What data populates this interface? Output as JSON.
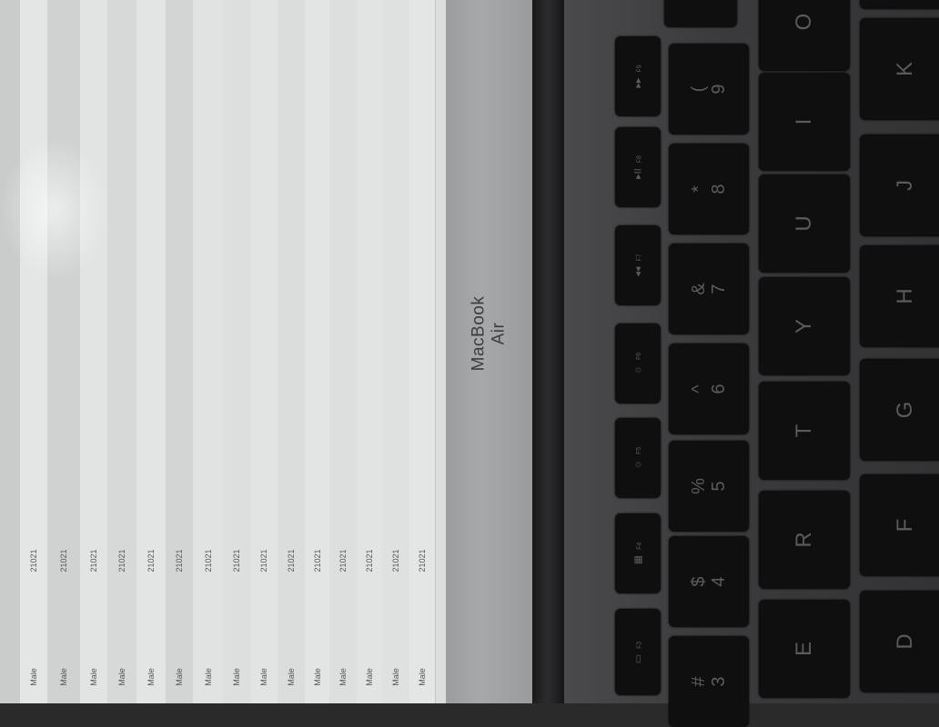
{
  "screen": {
    "table_rows": [
      {
        "gender": "Male",
        "code": "21021"
      },
      {
        "gender": "Male",
        "code": "21021"
      },
      {
        "gender": "Male",
        "code": "21021"
      },
      {
        "gender": "Male",
        "code": "21021"
      },
      {
        "gender": "Male",
        "code": "21021"
      },
      {
        "gender": "Male",
        "code": "21021"
      },
      {
        "gender": "Male",
        "code": "21021"
      },
      {
        "gender": "Male",
        "code": "21021"
      },
      {
        "gender": "Male",
        "code": "21021"
      },
      {
        "gender": "Male",
        "code": "21021"
      },
      {
        "gender": "Male",
        "code": "21021"
      },
      {
        "gender": "Male",
        "code": "21021"
      },
      {
        "gender": "Male",
        "code": "21021"
      },
      {
        "gender": "Male",
        "code": "21021"
      },
      {
        "gender": "Male",
        "code": "21021"
      }
    ]
  },
  "bezel": {
    "brand": "MacBook Air"
  },
  "keyboard": {
    "function_row": [
      {
        "icon": "▸▸",
        "label": "F9"
      },
      {
        "icon": "▸II",
        "label": "F8"
      },
      {
        "icon": "◂◂",
        "label": "F7"
      },
      {
        "icon": "☼",
        "label": "F6"
      },
      {
        "icon": "☼",
        "label": "F5"
      },
      {
        "icon": "▦",
        "label": "F4"
      },
      {
        "icon": "▭",
        "label": "F3"
      }
    ],
    "number_row": [
      {
        "top": "(",
        "bottom": "9"
      },
      {
        "top": "*",
        "bottom": "8"
      },
      {
        "top": "&",
        "bottom": "7"
      },
      {
        "top": "^",
        "bottom": "6"
      },
      {
        "top": "%",
        "bottom": "5"
      },
      {
        "top": "$",
        "bottom": "4"
      },
      {
        "top": "#",
        "bottom": "3"
      }
    ],
    "letter_row": [
      "O",
      "I",
      "U",
      "Y",
      "T",
      "R",
      "E"
    ],
    "home_row": [
      "K",
      "J",
      "H",
      "G",
      "F",
      "D"
    ]
  }
}
